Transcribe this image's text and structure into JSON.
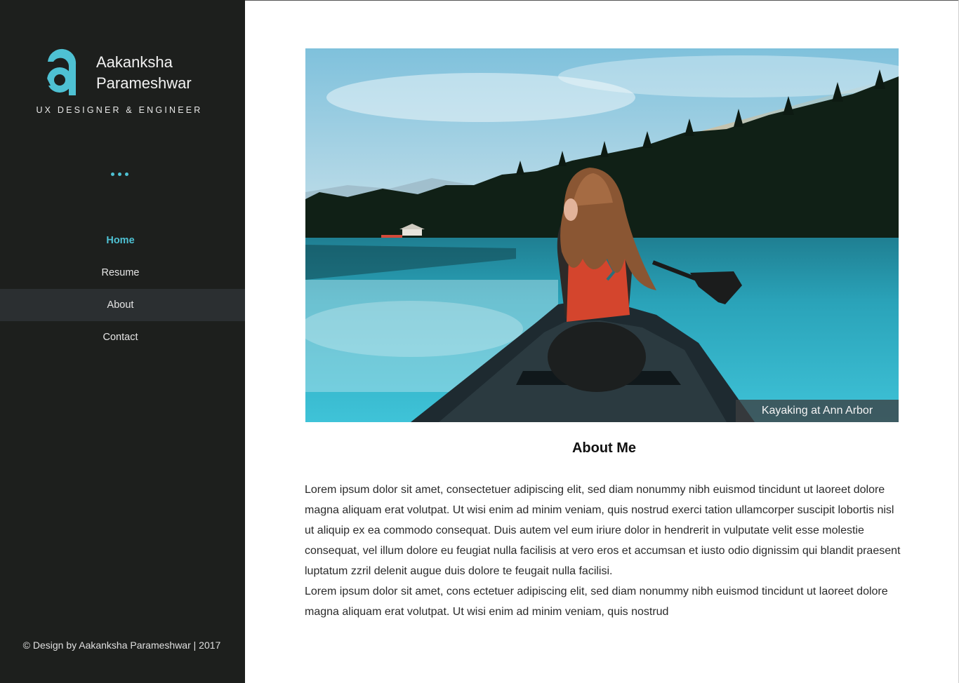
{
  "brand": {
    "name_line1": "Aakanksha",
    "name_line2": "Parameshwar",
    "tagline": "UX DESIGNER & ENGINEER",
    "logo_icon": "a-monogram-logo",
    "accent_color": "#4ec1d3"
  },
  "nav": {
    "items": [
      {
        "label": "Home",
        "state": "active"
      },
      {
        "label": "Resume",
        "state": "normal"
      },
      {
        "label": "About",
        "state": "hover"
      },
      {
        "label": "Contact",
        "state": "normal"
      }
    ]
  },
  "footer": {
    "text": "© Design by Aakanksha Parameshwar | 2017"
  },
  "main": {
    "hero_caption": "Kayaking at Ann Arbor",
    "title": "About Me",
    "paragraphs": [
      "Lorem ipsum dolor sit amet, consectetuer adipiscing elit, sed diam nonummy nibh euismod tincidunt ut laoreet dolore magna aliquam erat volutpat. Ut wisi enim ad minim veniam, quis nostrud exerci tation ullamcorper suscipit lobortis nisl ut aliquip ex ea commodo consequat. Duis autem vel eum iriure dolor in hendrerit in vulputate velit esse molestie consequat, vel illum dolore eu feugiat nulla facilisis at vero eros et accumsan et iusto odio dignissim qui blandit praesent luptatum zzril delenit augue duis dolore te feugait nulla facilisi.",
      "Lorem ipsum dolor sit amet, cons ectetuer adipiscing elit, sed diam nonummy nibh euismod tincidunt ut laoreet dolore magna aliquam erat volutpat. Ut wisi enim ad minim veniam, quis nostrud"
    ]
  }
}
